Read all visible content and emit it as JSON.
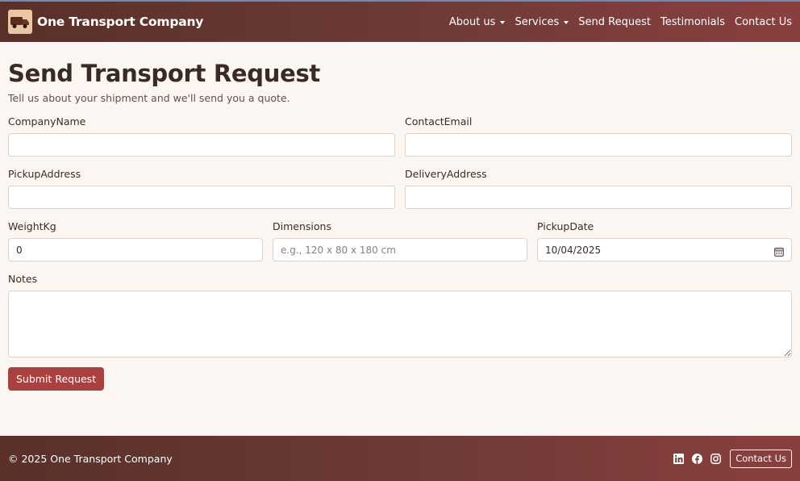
{
  "brand": {
    "name": "One Transport Company",
    "logo_icon": "truck-icon"
  },
  "nav": {
    "items": [
      {
        "label": "About us",
        "dropdown": true
      },
      {
        "label": "Services",
        "dropdown": true
      },
      {
        "label": "Send Request",
        "dropdown": false
      },
      {
        "label": "Testimonials",
        "dropdown": false
      },
      {
        "label": "Contact Us",
        "dropdown": false
      }
    ]
  },
  "page": {
    "title": "Send Transport Request",
    "subtitle": "Tell us about your shipment and we'll send you a quote."
  },
  "form": {
    "company_name": {
      "label": "CompanyName",
      "value": "",
      "placeholder": ""
    },
    "contact_email": {
      "label": "ContactEmail",
      "value": "",
      "placeholder": ""
    },
    "pickup_address": {
      "label": "PickupAddress",
      "value": "",
      "placeholder": ""
    },
    "delivery_address": {
      "label": "DeliveryAddress",
      "value": "",
      "placeholder": ""
    },
    "weight": {
      "label": "WeightKg",
      "value": "0"
    },
    "dimensions": {
      "label": "Dimensions",
      "value": "",
      "placeholder": "e.g., 120 x 80 x 180 cm"
    },
    "pickup_date": {
      "label": "PickupDate",
      "value": "10/04/2025",
      "icon": "calendar-icon"
    },
    "notes": {
      "label": "Notes",
      "value": ""
    },
    "submit_label": "Submit Request"
  },
  "footer": {
    "copyright": "© 2025 One Transport Company",
    "social": [
      "linkedin-icon",
      "facebook-icon",
      "instagram-icon"
    ],
    "contact_label": "Contact Us"
  },
  "colors": {
    "nav_start": "#5a3029",
    "nav_end": "#8a3f3f",
    "accent": "#a8413f",
    "background": "#fcf6f3"
  }
}
